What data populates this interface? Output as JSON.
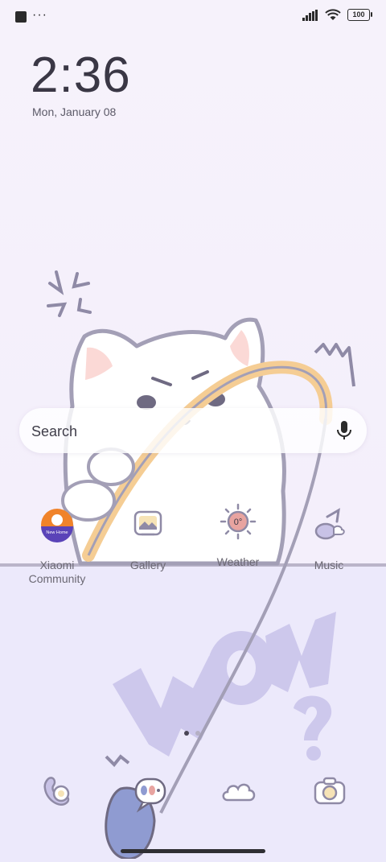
{
  "status_bar": {
    "left_icons": [
      "notification-square-icon",
      "more-dots-icon"
    ],
    "more_text": "···",
    "battery": "100"
  },
  "clock": {
    "time": "2:36",
    "date": "Mon, January 08"
  },
  "search": {
    "placeholder": "Search",
    "icon": "microphone-icon"
  },
  "apps": [
    {
      "label": "Xiaomi Community",
      "icon": "xiaomi-community-icon",
      "badge": "New Home"
    },
    {
      "label": "Gallery",
      "icon": "gallery-icon"
    },
    {
      "label": "Weather",
      "icon": "weather-sun-icon",
      "temp": "0°"
    },
    {
      "label": "Music",
      "icon": "music-note-icon"
    }
  ],
  "page_indicator": {
    "count": 2,
    "active": 0
  },
  "dock": [
    {
      "icon": "phone-icon"
    },
    {
      "icon": "messages-icon"
    },
    {
      "icon": "browser-cloud-icon"
    },
    {
      "icon": "camera-icon"
    }
  ],
  "colors": {
    "outline": "#9c97b2",
    "accent": "#f3c88f",
    "panel": "#ece9fb",
    "wow": "#cdc8ec"
  }
}
